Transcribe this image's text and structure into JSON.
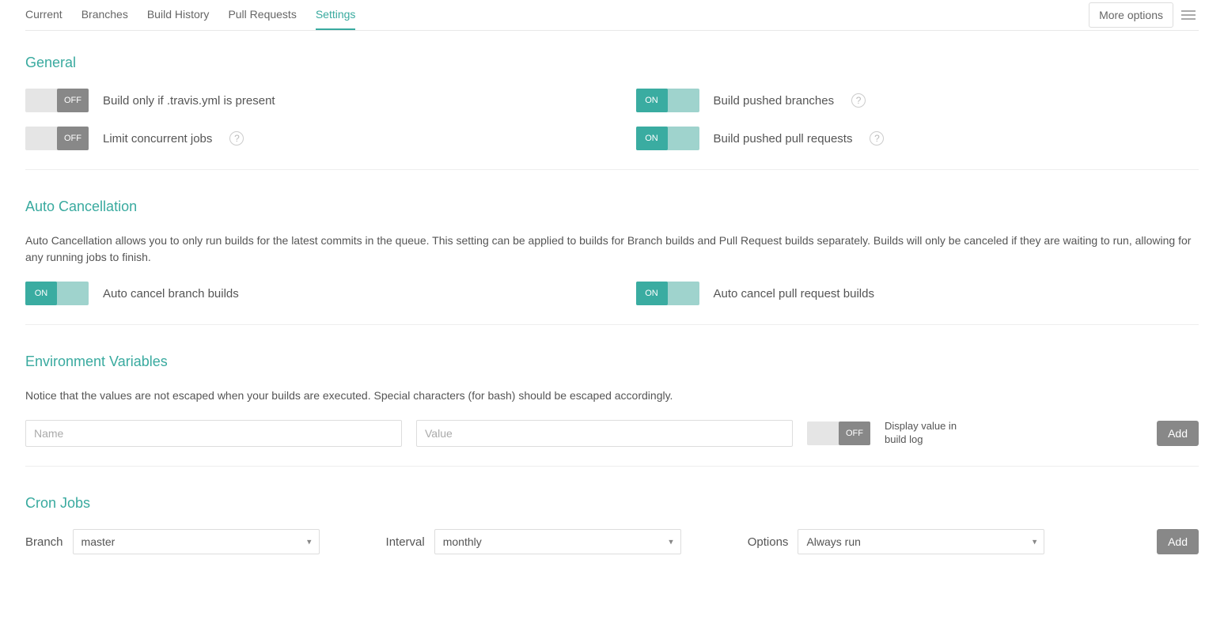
{
  "tabs": {
    "current": "Current",
    "branches": "Branches",
    "build_history": "Build History",
    "pull_requests": "Pull Requests",
    "settings": "Settings"
  },
  "more_options": "More options",
  "toggle_on_label": "ON",
  "toggle_off_label": "OFF",
  "general": {
    "title": "General",
    "travis_yml_label": "Build only if .travis.yml is present",
    "limit_jobs_label": "Limit concurrent jobs",
    "pushed_branches_label": "Build pushed branches",
    "pushed_prs_label": "Build pushed pull requests"
  },
  "auto_cancel": {
    "title": "Auto Cancellation",
    "description": "Auto Cancellation allows you to only run builds for the latest commits in the queue. This setting can be applied to builds for Branch builds and Pull Request builds separately. Builds will only be canceled if they are waiting to run, allowing for any running jobs to finish.",
    "branch_label": "Auto cancel branch builds",
    "pr_label": "Auto cancel pull request builds"
  },
  "env": {
    "title": "Environment Variables",
    "description": "Notice that the values are not escaped when your builds are executed. Special characters (for bash) should be escaped accordingly.",
    "name_placeholder": "Name",
    "value_placeholder": "Value",
    "display_label": "Display value in build log",
    "add_button": "Add"
  },
  "cron": {
    "title": "Cron Jobs",
    "branch_label": "Branch",
    "branch_value": "master",
    "interval_label": "Interval",
    "interval_value": "monthly",
    "options_label": "Options",
    "options_value": "Always run",
    "add_button": "Add"
  }
}
